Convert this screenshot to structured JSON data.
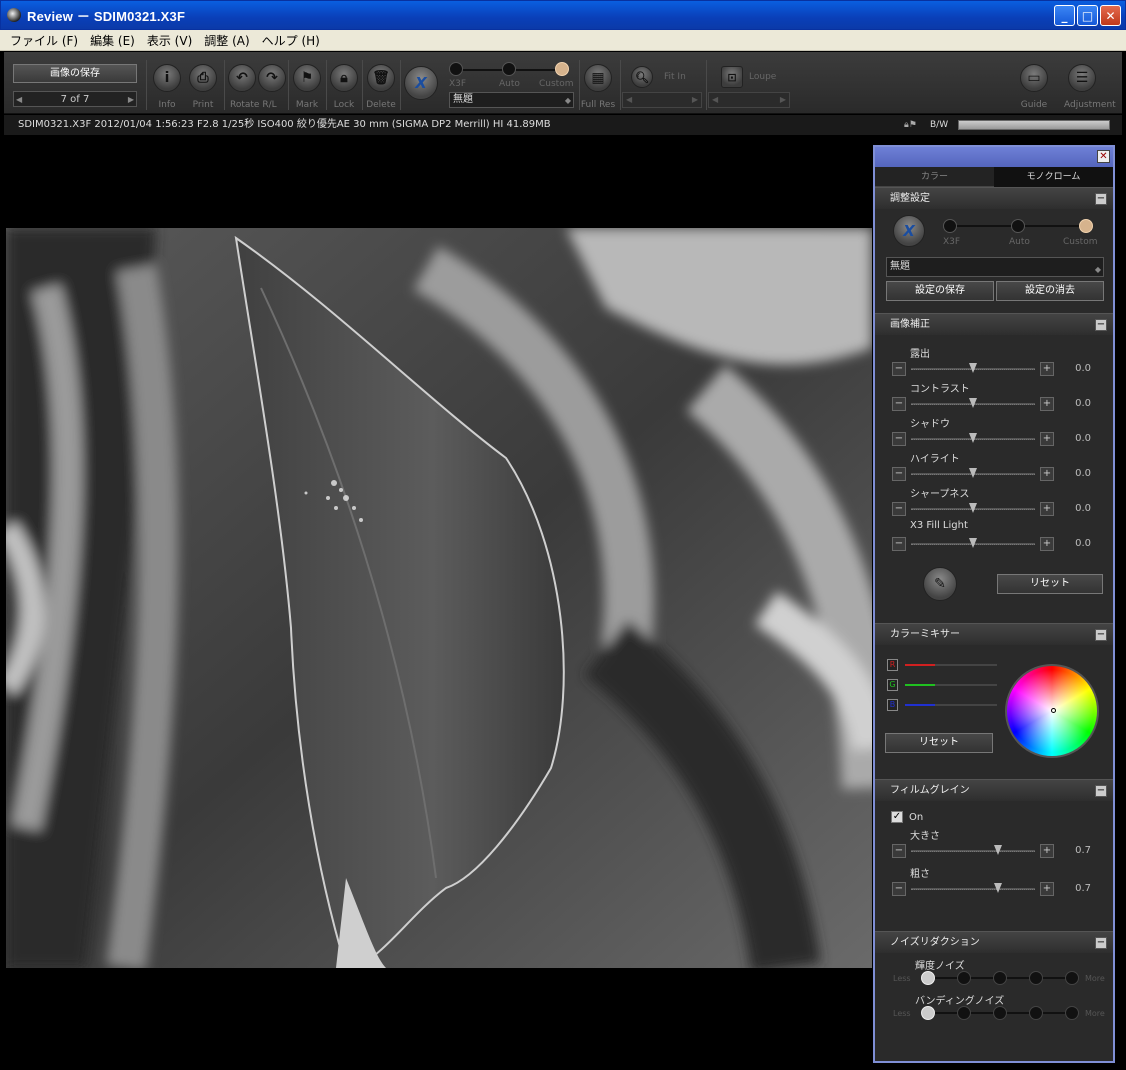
{
  "window": {
    "title": "Review － SDIM0321.X3F",
    "min_label": "_",
    "max_label": "□",
    "close_label": "✕"
  },
  "menu": [
    "ファイル (F)",
    "編集 (E)",
    "表示 (V)",
    "調整 (A)",
    "ヘルプ (H)"
  ],
  "toolbar": {
    "save_label": "画像の保存",
    "nav_label": "7 of 7",
    "buttons": {
      "info": "Info",
      "print": "Print",
      "rotate": "Rotate R/L",
      "mark": "Mark",
      "lock": "Lock",
      "delete": "Delete",
      "full_res": "Full Res",
      "fit_in": "Fit In",
      "loupe": "Loupe",
      "guide": "Guide",
      "adjustment": "Adjustment"
    },
    "modes": [
      "X3F",
      "Auto",
      "Custom"
    ],
    "mode_select": "無題"
  },
  "infobar": {
    "text": "SDIM0321.X3F 2012/01/04 1:56:23 F2.8 1/25秒  ISO400 絞り優先AE 30 mm (SIGMA DP2 Merrill) HI 41.89MB",
    "bw": "B/W"
  },
  "panel": {
    "tabs": [
      "カラー",
      "モノクローム"
    ],
    "settings": {
      "header": "調整設定",
      "modes": [
        "X3F",
        "Auto",
        "Custom"
      ],
      "select_value": "無題",
      "save_btn": "設定の保存",
      "delete_btn": "設定の消去"
    },
    "correction": {
      "header": "画像補正",
      "sliders": [
        {
          "label": "露出",
          "value": "0.0",
          "position": 0.5
        },
        {
          "label": "コントラスト",
          "value": "0.0",
          "position": 0.5
        },
        {
          "label": "シャドウ",
          "value": "0.0",
          "position": 0.5
        },
        {
          "label": "ハイライト",
          "value": "0.0",
          "position": 0.5
        },
        {
          "label": "シャープネス",
          "value": "0.0",
          "position": 0.5
        },
        {
          "label": "X3 Fill Light",
          "value": "0.0",
          "position": 0.5
        }
      ],
      "reset_btn": "リセット"
    },
    "mixer": {
      "header": "カラーミキサー",
      "channels": [
        {
          "label": "R",
          "color": "#d02020",
          "level": 0.33
        },
        {
          "label": "G",
          "color": "#20c020",
          "level": 0.33
        },
        {
          "label": "B",
          "color": "#2030d0",
          "level": 0.33
        }
      ],
      "reset_btn": "リセット"
    },
    "grain": {
      "header": "フィルムグレイン",
      "on_label": "On",
      "sliders": [
        {
          "label": "大きさ",
          "value": "0.7",
          "position": 0.7
        },
        {
          "label": "粗さ",
          "value": "0.7",
          "position": 0.7
        }
      ]
    },
    "noise": {
      "header": "ノイズリダクション",
      "less": "Less",
      "more": "More",
      "rows": [
        {
          "label": "輝度ノイズ",
          "selected": 0
        },
        {
          "label": "バンディングノイズ",
          "selected": 0
        }
      ]
    }
  }
}
